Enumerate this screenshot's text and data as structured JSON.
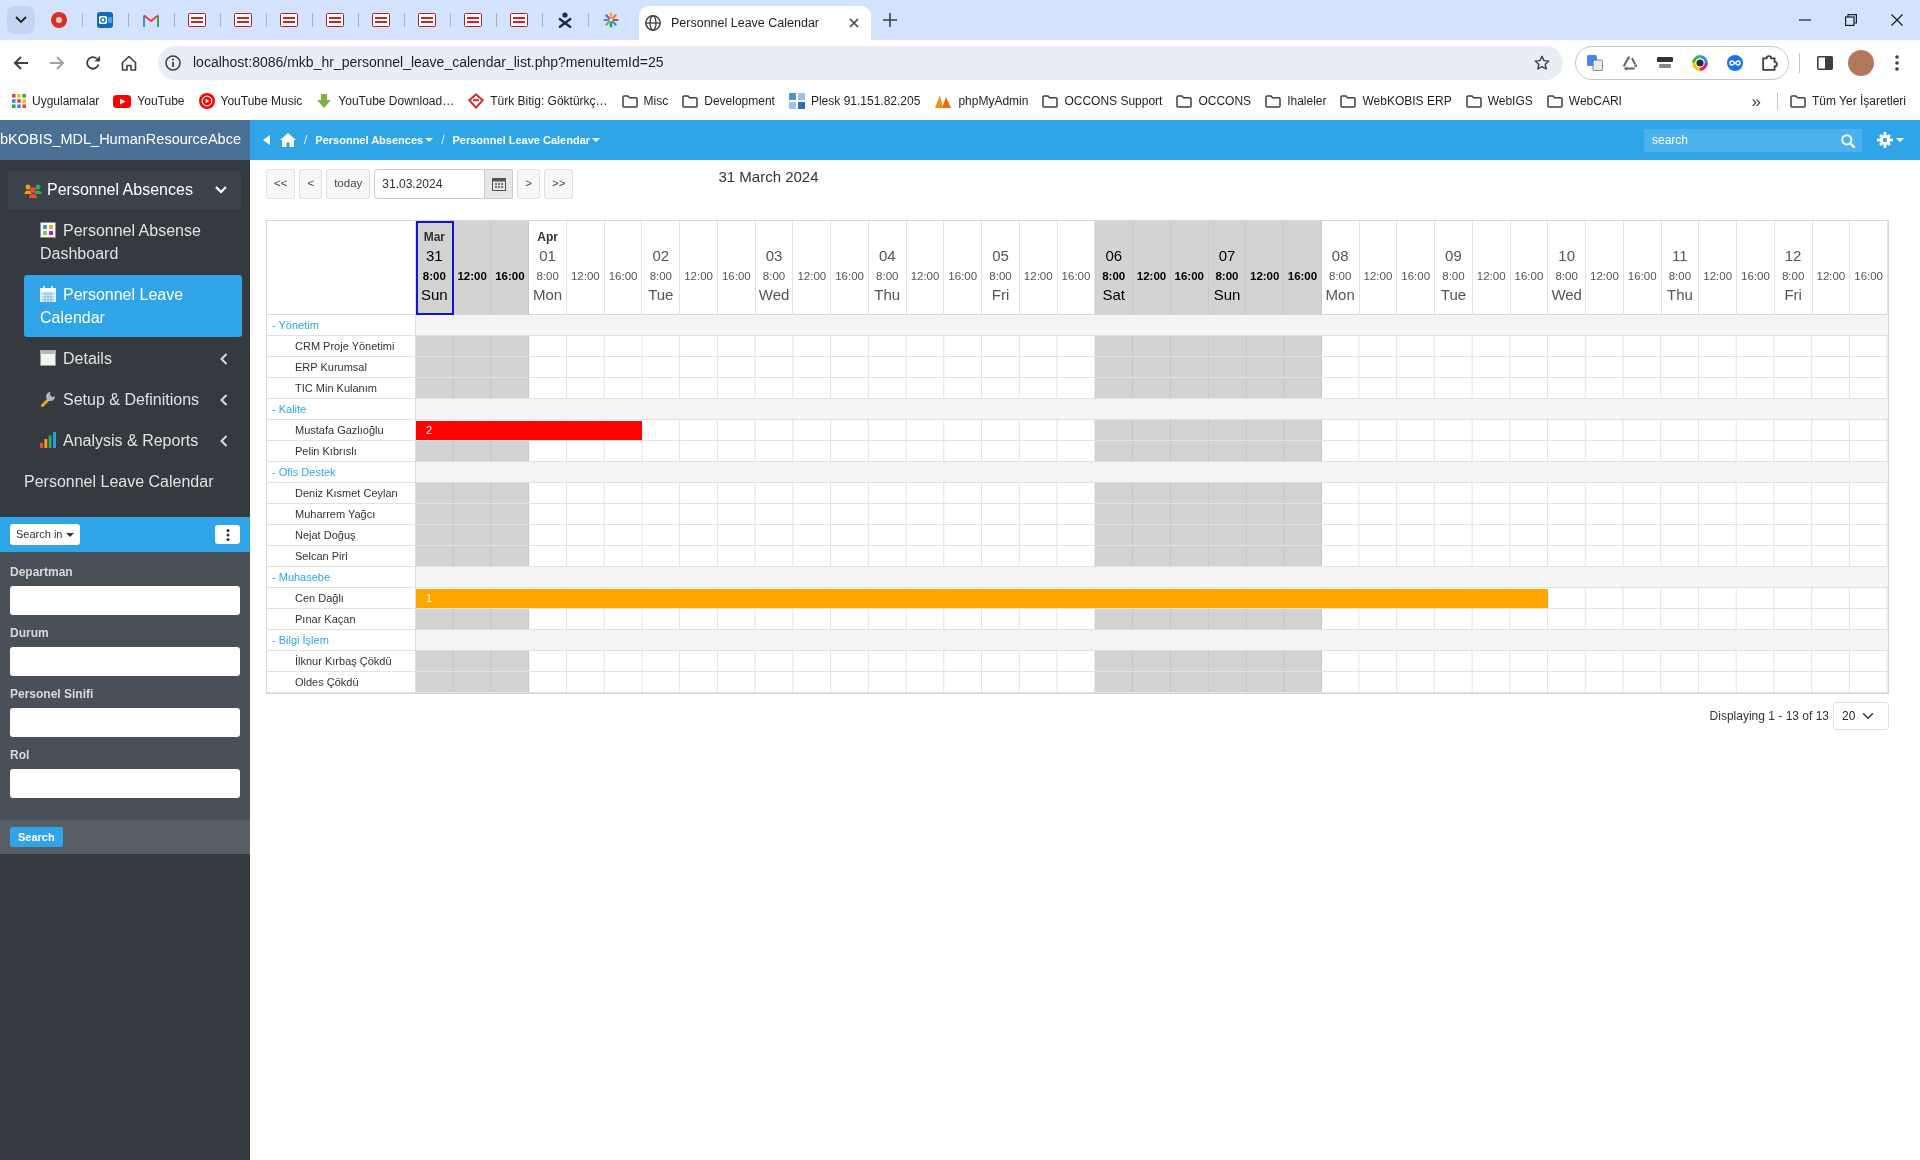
{
  "browser": {
    "tabs": [
      {
        "kind": "dot",
        "selected": false
      },
      {
        "kind": "tile",
        "selected": false
      },
      {
        "kind": "envelope",
        "selected": false
      },
      {
        "kind": "logo",
        "selected": false
      },
      {
        "kind": "logo",
        "selected": false
      },
      {
        "kind": "logo",
        "selected": false
      },
      {
        "kind": "logo",
        "selected": false
      },
      {
        "kind": "logo",
        "selected": false
      },
      {
        "kind": "logo",
        "selected": false
      },
      {
        "kind": "logo",
        "selected": false
      },
      {
        "kind": "logo",
        "selected": false
      },
      {
        "kind": "figure",
        "selected": false
      },
      {
        "kind": "sparkle",
        "selected": false
      },
      {
        "kind": "globe",
        "title": "Personnel Leave Calendar",
        "selected": true
      }
    ],
    "address": "localhost:8086/mkb_hr_personnel_leave_calendar_list.php?menuItemId=25",
    "bookmarks": [
      {
        "kind": "apps",
        "label": "Uygulamalar"
      },
      {
        "kind": "video",
        "label": "YouTube"
      },
      {
        "kind": "music",
        "label": "YouTube Music"
      },
      {
        "kind": "download",
        "label": "YouTube Download…"
      },
      {
        "kind": "diamond",
        "label": "Türk Bitig: Göktürkç…"
      },
      {
        "kind": "folder",
        "label": "Misc"
      },
      {
        "kind": "folder",
        "label": "Development"
      },
      {
        "kind": "server",
        "label": "Plesk 91.151.82.205"
      },
      {
        "kind": "sail",
        "label": "phpMyAdmin"
      },
      {
        "kind": "folder",
        "label": "OCCONS Support"
      },
      {
        "kind": "folder",
        "label": "OCCONS"
      },
      {
        "kind": "folder",
        "label": "Ihaleler"
      },
      {
        "kind": "folder",
        "label": "WebKOBIS ERP"
      },
      {
        "kind": "folder",
        "label": "WebIGS"
      },
      {
        "kind": "folder",
        "label": "WebCARI"
      }
    ],
    "bookmarks_overflow": "»",
    "all_bookmarks": {
      "kind": "folder",
      "label": "Tüm Yer İşaretleri"
    }
  },
  "app": {
    "brand": "bKOBIS_MDL_HumanResourceAbce",
    "breadcrumbs": [
      {
        "separator": "/",
        "label": "Personnel Absences"
      },
      {
        "separator": "/",
        "label": "Personnel Leave Calendar"
      }
    ],
    "search": {
      "placeholder": "search"
    }
  },
  "sidebar": {
    "menu": {
      "kind": "people",
      "label": "Personnel Absences",
      "expanded": true,
      "children": [
        {
          "kind": "dashboard",
          "label": "Personnel Absense Dashboard",
          "selected": false
        },
        {
          "kind": "calendar",
          "label": "Personnel Leave Calendar",
          "selected": true
        },
        {
          "kind": "sheet",
          "label": "Details",
          "selected": false,
          "expanded": false
        },
        {
          "kind": "wrench",
          "label": "Setup & Definitions",
          "selected": false,
          "expanded": false
        },
        {
          "kind": "chart",
          "label": "Analysis & Reports",
          "selected": false,
          "expanded": false
        }
      ]
    },
    "page_title": "Personnel Leave Calendar",
    "search_panel": {
      "menu_button": "Search in",
      "fields": [
        {
          "label": "Departman"
        },
        {
          "label": "Durum"
        },
        {
          "label": "Personel Sinifi"
        },
        {
          "label": "Rol"
        }
      ],
      "submit": "Search"
    }
  },
  "calendar": {
    "toolbar": [
      {
        "kind": "button",
        "label": "<<"
      },
      {
        "kind": "button",
        "label": "<"
      },
      {
        "kind": "button",
        "label": "today"
      },
      {
        "kind": "date",
        "value": "31.03.2024"
      },
      {
        "kind": "button",
        "label": ">"
      },
      {
        "kind": "button",
        "label": ">>"
      }
    ],
    "title": "31 March 2024",
    "days": [
      {
        "month": "Mar",
        "day": "31",
        "times": [
          "8:00",
          "12:00",
          "16:00"
        ],
        "weekday": "Sun",
        "weekend": true,
        "today": true
      },
      {
        "month": "Apr",
        "day": "01",
        "times": [
          "8:00",
          "12:00",
          "16:00"
        ],
        "weekday": "Mon",
        "weekend": false,
        "today": false
      },
      {
        "day": "02",
        "times": [
          "8:00",
          "12:00",
          "16:00"
        ],
        "weekday": "Tue",
        "weekend": false,
        "today": false
      },
      {
        "day": "03",
        "times": [
          "8:00",
          "12:00",
          "16:00"
        ],
        "weekday": "Wed",
        "weekend": false,
        "today": false
      },
      {
        "day": "04",
        "times": [
          "8:00",
          "12:00",
          "16:00"
        ],
        "weekday": "Thu",
        "weekend": false,
        "today": false
      },
      {
        "day": "05",
        "times": [
          "8:00",
          "12:00",
          "16:00"
        ],
        "weekday": "Fri",
        "weekend": false,
        "today": false
      },
      {
        "day": "06",
        "times": [
          "8:00",
          "12:00",
          "16:00"
        ],
        "weekday": "Sat",
        "weekend": true,
        "today": false
      },
      {
        "day": "07",
        "times": [
          "8:00",
          "12:00",
          "16:00"
        ],
        "weekday": "Sun",
        "weekend": true,
        "today": false
      },
      {
        "day": "08",
        "times": [
          "8:00",
          "12:00",
          "16:00"
        ],
        "weekday": "Mon",
        "weekend": false,
        "today": false
      },
      {
        "day": "09",
        "times": [
          "8:00",
          "12:00",
          "16:00"
        ],
        "weekday": "Tue",
        "weekend": false,
        "today": false
      },
      {
        "day": "10",
        "times": [
          "8:00",
          "12:00",
          "16:00"
        ],
        "weekday": "Wed",
        "weekend": false,
        "today": false
      },
      {
        "day": "11",
        "times": [
          "8:00",
          "12:00",
          "16:00"
        ],
        "weekday": "Thu",
        "weekend": false,
        "today": false
      },
      {
        "day": "12",
        "times": [
          "8:00",
          "12:00",
          "16:00"
        ],
        "weekday": "Fri",
        "weekend": false,
        "today": false
      }
    ],
    "groups": [
      {
        "label": "- Yönetim",
        "people": [
          {
            "name": "CRM Proje Yönetimi"
          },
          {
            "name": "ERP Kurumsal"
          },
          {
            "name": "TIC Min Kulanım"
          }
        ]
      },
      {
        "label": "- Kalite",
        "people": [
          {
            "name": "Mustafa Gazlıoğlu",
            "events": [
              {
                "label": "2",
                "color": "#ff0000",
                "level": 0.1538
              }
            ]
          },
          {
            "name": "Pelin Kıbrıslı"
          }
        ]
      },
      {
        "label": "- Ofis Destek",
        "people": [
          {
            "name": "Deniz Kısmet Ceylan"
          },
          {
            "name": "Muharrem Yağcı"
          },
          {
            "name": "Nejat Doğuş"
          },
          {
            "name": "Selcan Piri"
          }
        ]
      },
      {
        "label": "- Muhasebe",
        "people": [
          {
            "name": "Cen Dağlı",
            "events": [
              {
                "label": "1",
                "color": "#ffa500",
                "level": 0.7692
              }
            ]
          },
          {
            "name": "Pınar Kaçan"
          }
        ]
      },
      {
        "label": "- Bilgi İşlem",
        "people": [
          {
            "name": "İlknur Kırbaş Çökdü"
          },
          {
            "name": "Oldes Çökdü"
          }
        ]
      }
    ],
    "footer": {
      "summary": "Displaying 1 - 13 of 13",
      "page_size": "20"
    }
  }
}
